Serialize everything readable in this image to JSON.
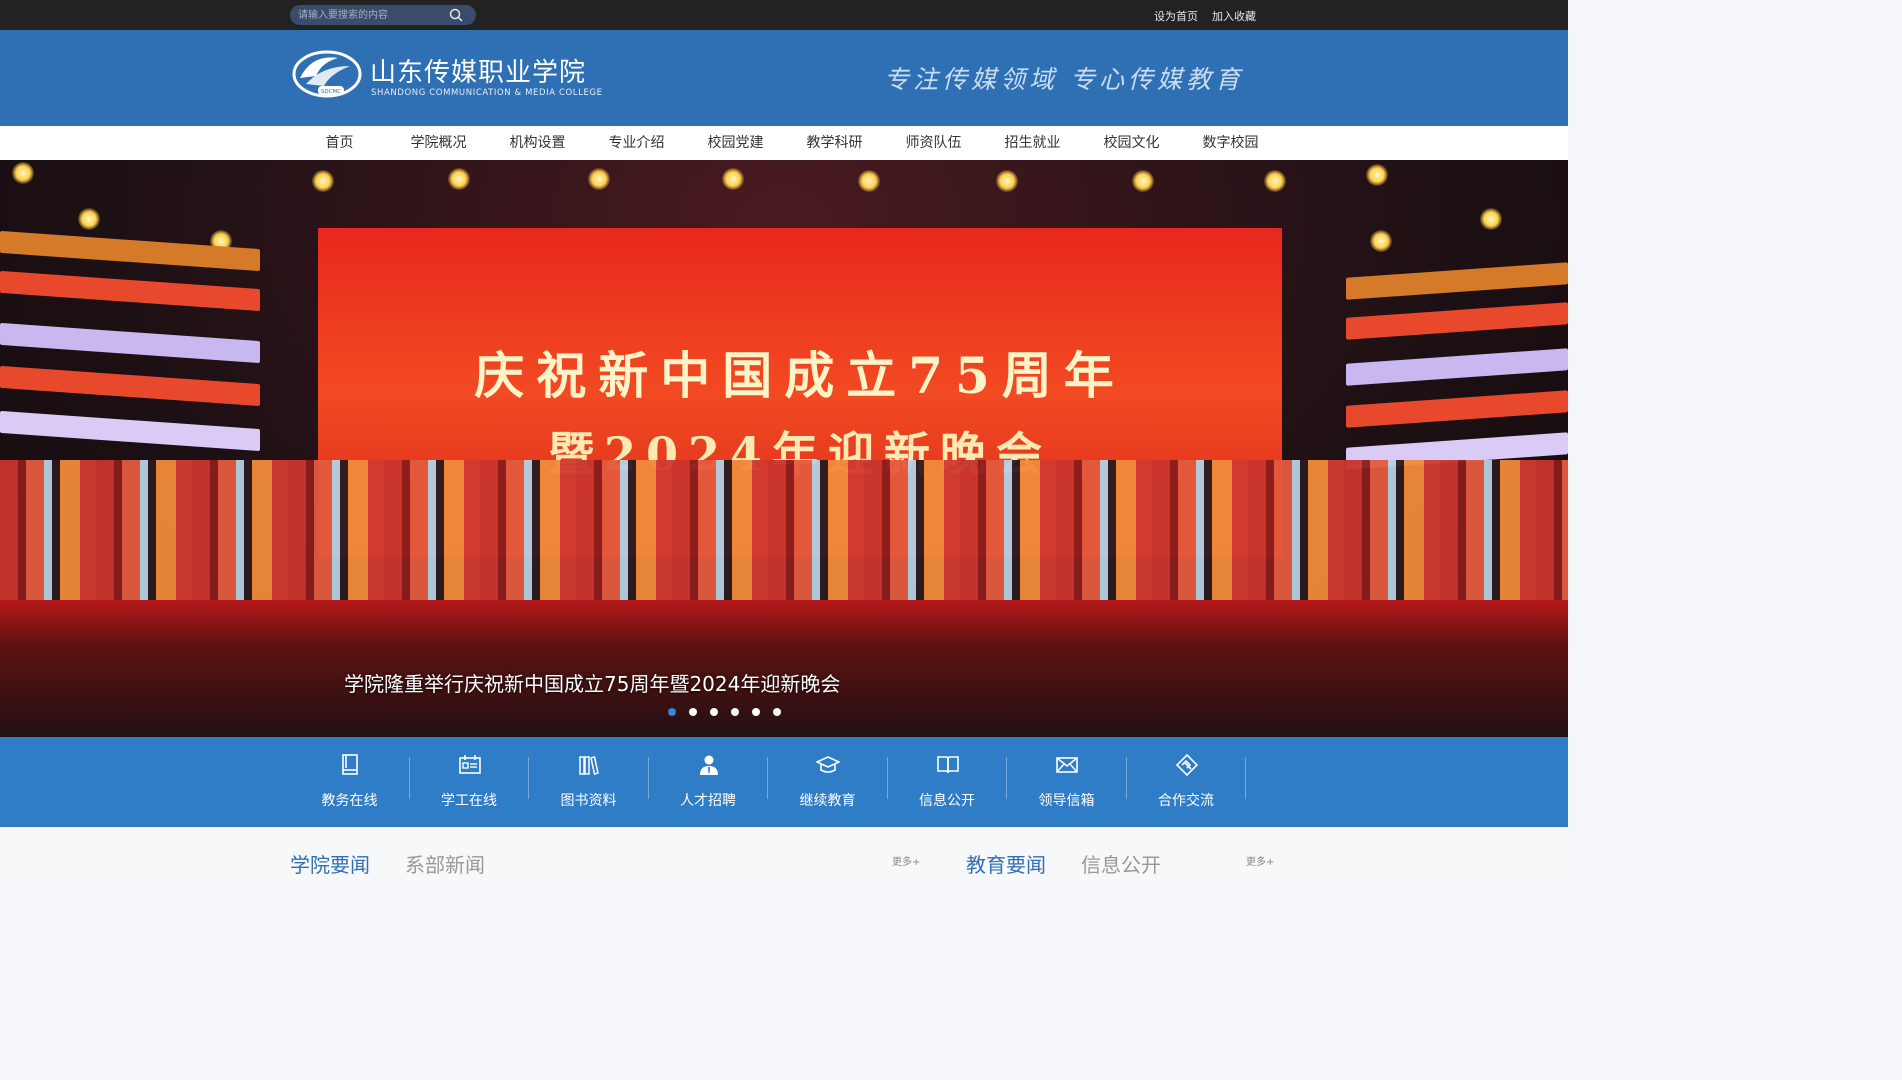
{
  "topbar": {
    "search_placeholder": "请输入要搜索的内容",
    "links": [
      "设为首页",
      "加入收藏"
    ]
  },
  "header": {
    "college_name": "山东传媒职业学院",
    "college_name_en": "SHANDONG COMMUNICATION & MEDIA COLLEGE",
    "slogan": "专注传媒领域  专心传媒教育"
  },
  "nav": {
    "items": [
      "首页",
      "学院概况",
      "机构设置",
      "专业介绍",
      "校园党建",
      "教学科研",
      "师资队伍",
      "招生就业",
      "校园文化",
      "数字校园"
    ]
  },
  "banner": {
    "screen_line1": "庆祝新中国成立75周年",
    "screen_line2": "暨2024年迎新晚会",
    "caption": "学院隆重举行庆祝新中国成立75周年暨2024年迎新晚会",
    "slide_count": 6,
    "active_slide": 1
  },
  "quick_links": [
    {
      "label": "教务在线",
      "icon": "book-icon"
    },
    {
      "label": "学工在线",
      "icon": "id-card-icon"
    },
    {
      "label": "图书资料",
      "icon": "books-icon"
    },
    {
      "label": "人才招聘",
      "icon": "person-icon"
    },
    {
      "label": "继续教育",
      "icon": "graduation-cap-icon"
    },
    {
      "label": "信息公开",
      "icon": "open-book-icon"
    },
    {
      "label": "领导信箱",
      "icon": "mail-icon"
    },
    {
      "label": "合作交流",
      "icon": "handshake-icon"
    }
  ],
  "news": {
    "left_tabs": [
      "学院要闻",
      "系部新闻"
    ],
    "right_tabs": [
      "教育要闻",
      "信息公开"
    ],
    "more_label": "更多+"
  },
  "colors": {
    "header_blue": "#2f6fb4",
    "quick_blue": "#2f7cc7",
    "topbar": "#222222"
  }
}
